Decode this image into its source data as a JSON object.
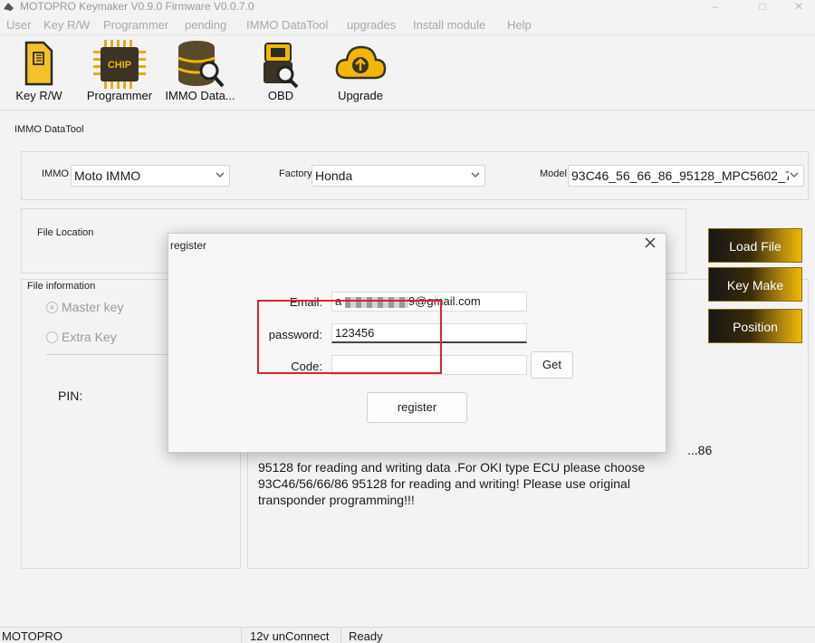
{
  "window": {
    "title": "MOTOPRO Keymaker V0.9.0 Firmware V0.0.7.0",
    "controls": [
      "–",
      "□",
      "✕"
    ]
  },
  "menu": [
    "User",
    "Key R/W",
    "Programmer",
    "pending",
    "IMMO DataTool",
    "upgrades",
    "Install module",
    "Help"
  ],
  "toolbar": {
    "key_rw": "Key R/W",
    "programmer": "Programmer",
    "immo_data": "IMMO Data...",
    "obd": "OBD",
    "upgrade": "Upgrade",
    "chip_icon_text": "CHIP"
  },
  "main": {
    "section_title": "IMMO DataTool",
    "immo": {
      "label": "IMMO",
      "value": "Moto IMMO"
    },
    "factory": {
      "label": "Factory",
      "value": "Honda"
    },
    "model": {
      "label": "Model",
      "value": "93C46_56_66_86_95128_MPC5602_7"
    },
    "file_location_label": "File Location",
    "file_information_label": "File information",
    "master_key": "Master key",
    "extra_key": "Extra Key",
    "pin_label": "PIN:",
    "buttons": {
      "load_file": "Load File",
      "key_make": "Key Make",
      "position": "Position"
    },
    "info_text_partial": "...86",
    "info_lines": [
      "95128 for reading and writing data .For OKI type ECU please choose",
      "93C46/56/66/86 95128 for reading and writing! Please use original",
      "transponder programming!!!"
    ]
  },
  "dialog": {
    "title": "register",
    "email_label": "Email:",
    "email_prefix": "a",
    "email_suffix": "9@gmail.com",
    "password_label": "password:",
    "password_value": "123456",
    "code_label": "Code:",
    "code_value": "",
    "get_button": "Get",
    "register_button": "register"
  },
  "statusbar": {
    "app": "MOTOPRO",
    "connection": "12v unConnect",
    "state": "Ready"
  },
  "colors": {
    "accent_gold": "#f0b800",
    "highlight_red": "#d9252b",
    "hand_yellow": "#ffe600"
  }
}
